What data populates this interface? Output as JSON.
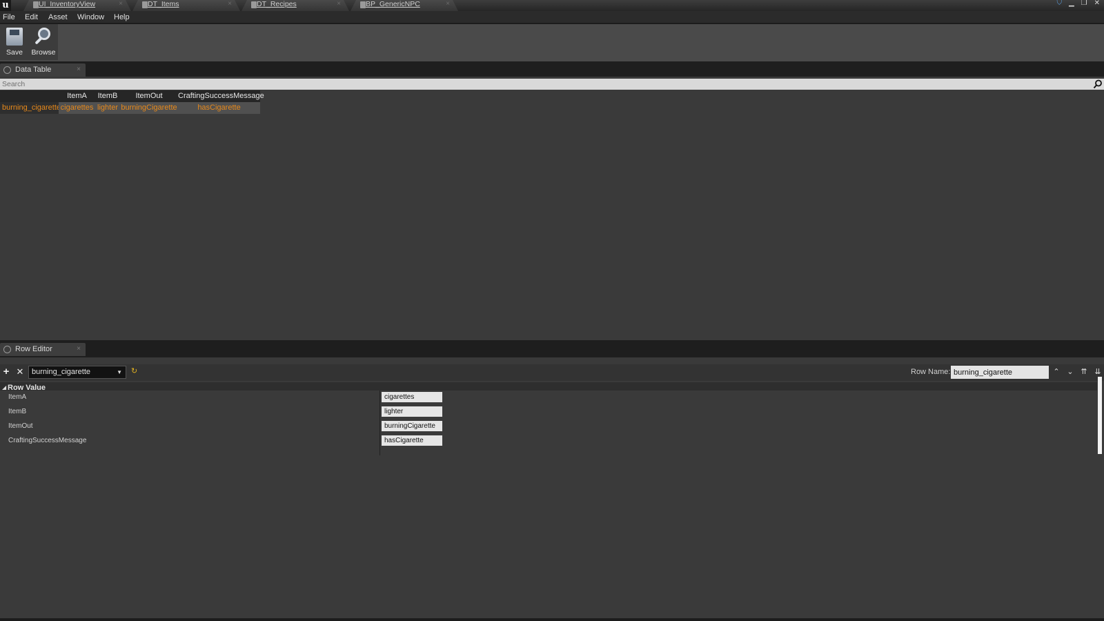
{
  "window": {
    "tabs": [
      {
        "label": "UI_InventoryView"
      },
      {
        "label": "DT_Items"
      },
      {
        "label": "DT_Recipes"
      },
      {
        "label": "BP_GenericNPC"
      }
    ],
    "close_glyph": "×"
  },
  "menu": {
    "items": [
      "File",
      "Edit",
      "Asset",
      "Window",
      "Help"
    ]
  },
  "toolbar": {
    "save_label": "Save",
    "browse_label": "Browse"
  },
  "data_table_panel": {
    "tab_label": "Data Table",
    "search_placeholder": "Search",
    "columns": [
      "",
      "ItemA",
      "ItemB",
      "ItemOut",
      "CraftingSuccessMessage"
    ],
    "rows": [
      {
        "name": "burning_cigarette",
        "ItemA": "cigarettes",
        "ItemB": "lighter",
        "ItemOut": "burningCigarette",
        "CraftingSuccessMessage": "hasCigarette"
      }
    ]
  },
  "row_editor_panel": {
    "tab_label": "Row Editor",
    "selected_row": "burning_cigarette",
    "row_name_label": "Row Name:",
    "row_name_value": "burning_cigarette",
    "category": "Row Value",
    "properties": [
      {
        "label": "ItemA",
        "value": "cigarettes"
      },
      {
        "label": "ItemB",
        "value": "lighter"
      },
      {
        "label": "ItemOut",
        "value": "burningCigarette"
      },
      {
        "label": "CraftingSuccessMessage",
        "value": "hasCigarette"
      }
    ]
  },
  "colors": {
    "accent_orange": "#e8891a",
    "panel_bg": "#3a3a3a"
  },
  "icons": {
    "add": "add-icon",
    "remove": "remove-icon",
    "reset": "reset-icon",
    "search": "search-icon"
  }
}
